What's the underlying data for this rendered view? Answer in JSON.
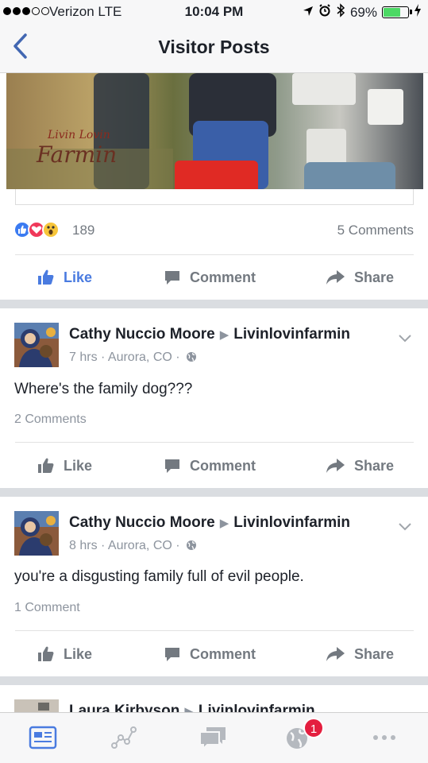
{
  "status_bar": {
    "carrier": "Verizon  LTE",
    "time": "10:04 PM",
    "battery": "69%",
    "battery_level": 0.69
  },
  "nav": {
    "title": "Visitor Posts",
    "back_icon": "chevron-left-icon"
  },
  "media": {
    "logo_line1": "Livin Lovin",
    "logo_line2": "Farmin"
  },
  "top_post": {
    "reaction_count": "189",
    "comments": "5 Comments",
    "actions": {
      "like": "Like",
      "comment": "Comment",
      "share": "Share"
    }
  },
  "posts": [
    {
      "author": "Cathy Nuccio Moore",
      "target": "Livinlovinfarmin",
      "meta": "7 hrs · Aurora, CO ·",
      "text": "Where's the family dog???",
      "comments": "2 Comments",
      "actions": {
        "like": "Like",
        "comment": "Comment",
        "share": "Share"
      }
    },
    {
      "author": "Cathy Nuccio Moore",
      "target": "Livinlovinfarmin",
      "meta": "8 hrs · Aurora, CO ·",
      "text": "you're a disgusting family full of evil people.",
      "comments": "1 Comment",
      "actions": {
        "like": "Like",
        "comment": "Comment",
        "share": "Share"
      }
    },
    {
      "author": "Laura Kirbyson",
      "target": "Livinlovinfarmin"
    }
  ],
  "tabbar": {
    "items": [
      "news-feed-icon",
      "activity-icon",
      "messages-icon",
      "notifications-globe-icon",
      "more-icon"
    ],
    "notification_badge": "1"
  },
  "colors": {
    "accent": "#4267b2",
    "like_blue": "#4a7be0",
    "badge_red": "#e41e3f"
  }
}
